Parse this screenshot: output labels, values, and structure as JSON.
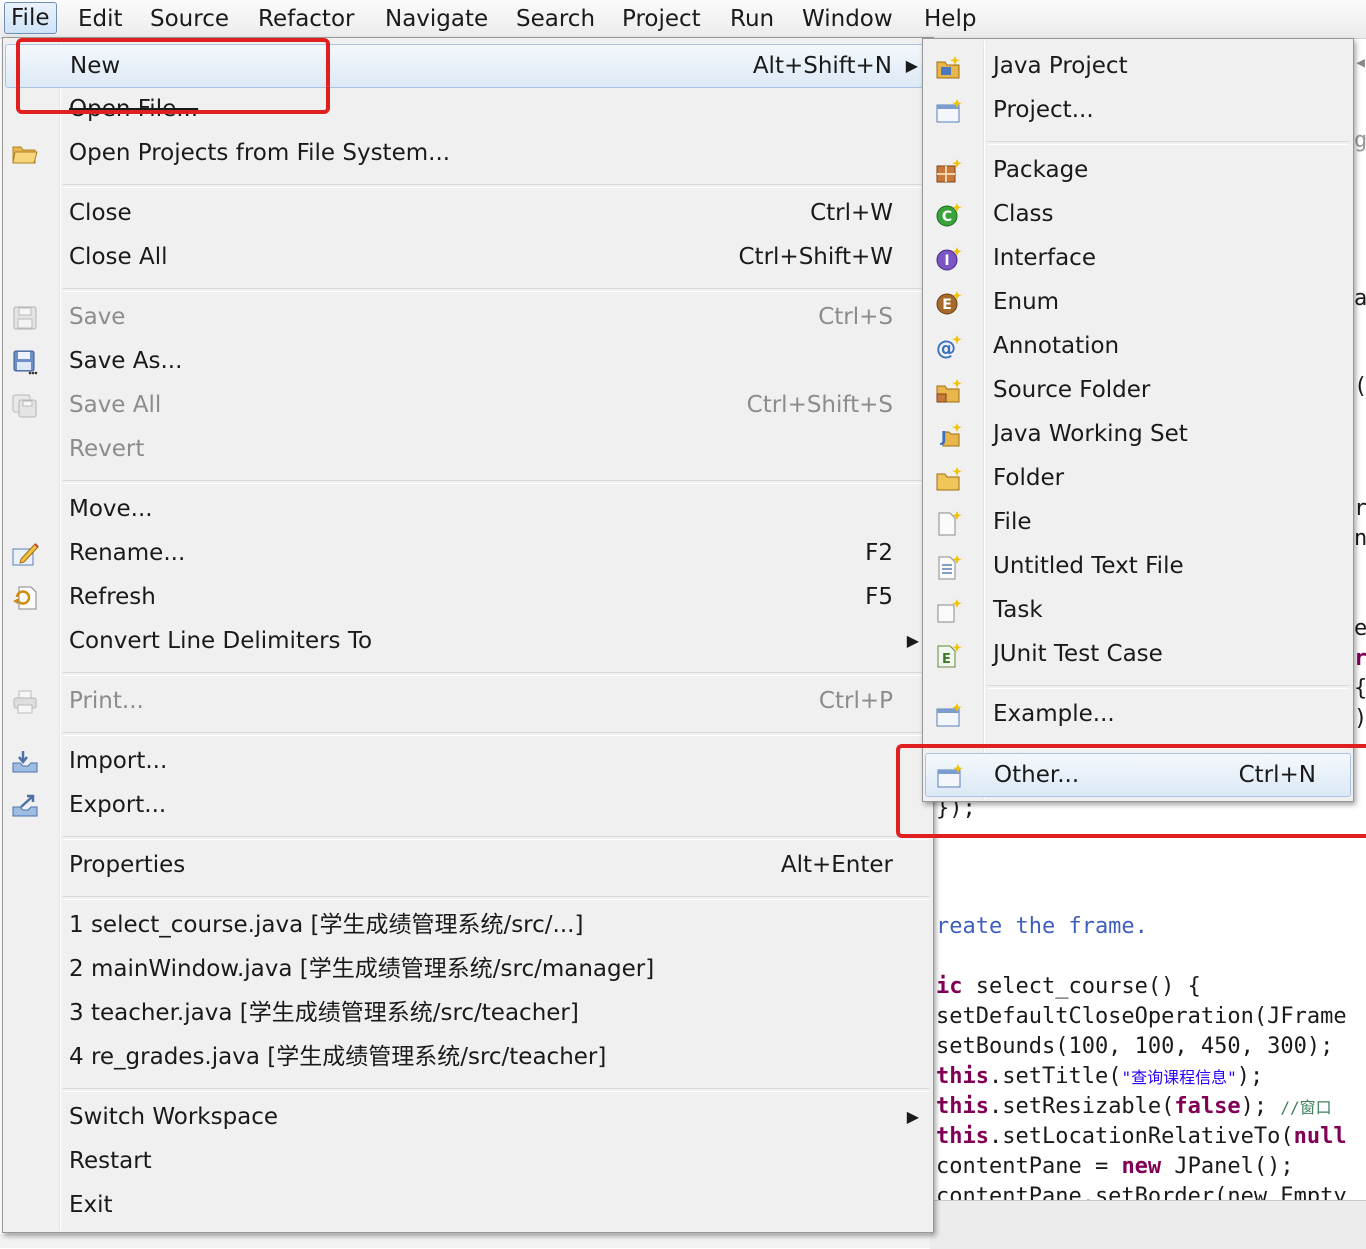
{
  "menubar": [
    "File",
    "Edit",
    "Source",
    "Refactor",
    "Navigate",
    "Search",
    "Project",
    "Run",
    "Window",
    "Help"
  ],
  "file_menu": {
    "new": {
      "label": "New",
      "accel": "Alt+Shift+N"
    },
    "open_file": {
      "label": "Open File..."
    },
    "open_projects": {
      "label": "Open Projects from File System..."
    },
    "close": {
      "label": "Close",
      "accel": "Ctrl+W"
    },
    "close_all": {
      "label": "Close All",
      "accel": "Ctrl+Shift+W"
    },
    "save": {
      "label": "Save",
      "accel": "Ctrl+S"
    },
    "save_as": {
      "label": "Save As..."
    },
    "save_all": {
      "label": "Save All",
      "accel": "Ctrl+Shift+S"
    },
    "revert": {
      "label": "Revert"
    },
    "move": {
      "label": "Move..."
    },
    "rename": {
      "label": "Rename...",
      "accel": "F2"
    },
    "refresh": {
      "label": "Refresh",
      "accel": "F5"
    },
    "convert": {
      "label": "Convert Line Delimiters To"
    },
    "print": {
      "label": "Print...",
      "accel": "Ctrl+P"
    },
    "import": {
      "label": "Import..."
    },
    "export": {
      "label": "Export..."
    },
    "properties": {
      "label": "Properties",
      "accel": "Alt+Enter"
    },
    "recent": [
      "1 select_course.java  [学生成绩管理系统/src/...]",
      "2 mainWindow.java  [学生成绩管理系统/src/manager]",
      "3 teacher.java  [学生成绩管理系统/src/teacher]",
      "4 re_grades.java  [学生成绩管理系统/src/teacher]"
    ],
    "switch_workspace": {
      "label": "Switch Workspace"
    },
    "restart": {
      "label": "Restart"
    },
    "exit": {
      "label": "Exit"
    }
  },
  "new_menu": {
    "java_project": "Java Project",
    "project": "Project...",
    "package": "Package",
    "class": "Class",
    "interface": "Interface",
    "enum": "Enum",
    "annotation": "Annotation",
    "source_folder": "Source Folder",
    "java_working_set": "Java Working Set",
    "folder": "Folder",
    "file": "File",
    "untitled_text_file": "Untitled Text File",
    "task": "Task",
    "junit_test_case": "JUnit Test Case",
    "example": "Example...",
    "other": {
      "label": "Other...",
      "accel": "Ctrl+N"
    }
  },
  "editor": {
    "brace_line": "});",
    "jdoc": "reate the frame.",
    "ctor_kw": "ic",
    "ctor_rest": " select_course() {",
    "l1": "setDefaultCloseOperation(JFrame",
    "l2": "setBounds(100, 100, 450, 300);",
    "l3_kw": "this",
    "l3_a": ".setTitle(",
    "l3_str": "\"查询课程信息\"",
    "l3_b": ");",
    "l4_kw": "this",
    "l4_a": ".setResizable(",
    "l4_kw2": "false",
    "l4_b": "); ",
    "l4_cmt": "//窗口",
    "l5_kw": "this",
    "l5_a": ".setLocationRelativeTo(",
    "l5_kw2": "null",
    "l6_a": "contentPane = ",
    "l6_kw": "new",
    "l6_b": " JPanel();",
    "l7": "contentPane.setBorder(new Empty"
  },
  "colors": {
    "highlight_box": "#e02020",
    "menu_bg": "#f0f0f0",
    "keyword": "#7f0055",
    "javadoc": "#3f5fbf",
    "string": "#2a00ff"
  }
}
